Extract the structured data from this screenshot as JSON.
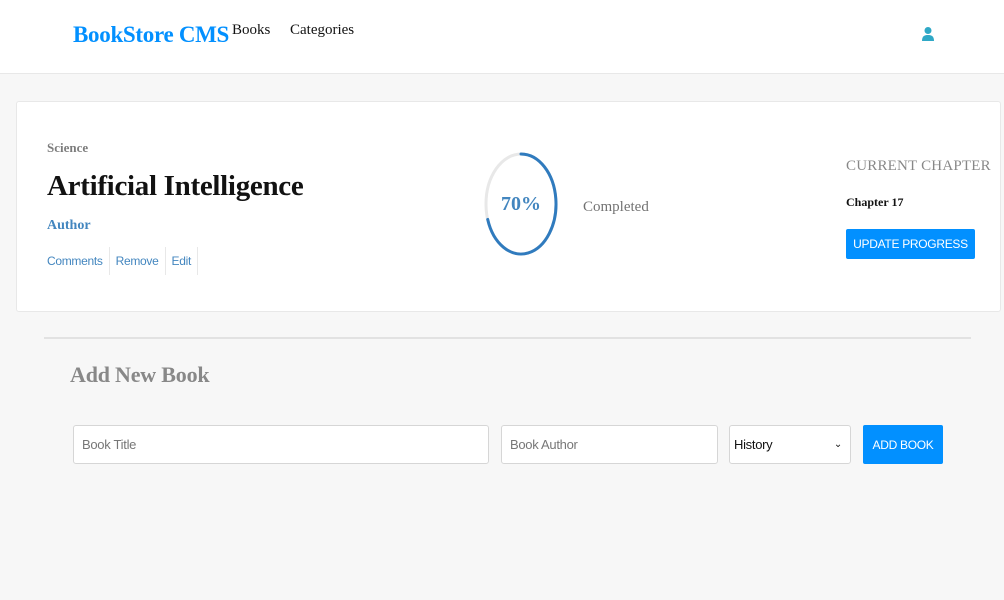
{
  "header": {
    "brand": "BookStore CMS",
    "nav": [
      {
        "label": "Books"
      },
      {
        "label": "Categories"
      }
    ],
    "user_icon": "user-icon"
  },
  "book": {
    "genre": "Science",
    "title": "Artificial Intelligence",
    "author": "Author",
    "actions": [
      {
        "label": "Comments"
      },
      {
        "label": "Remove"
      },
      {
        "label": "Edit"
      }
    ],
    "progress_percent": 70,
    "progress_label": "70%",
    "completed_label": "Completed",
    "current_chapter_heading": "CURRENT CHAPTER",
    "current_chapter": "Chapter 17",
    "update_button": "UPDATE PROGRESS"
  },
  "add_form": {
    "title": "Add New Book",
    "title_placeholder": "Book Title",
    "author_placeholder": "Book Author",
    "category_selected": "History",
    "submit_label": "ADD BOOK"
  },
  "colors": {
    "accent": "#0290ff",
    "link": "#4386bf",
    "ring_track": "#e8e8e8",
    "ring_fill": "#307bbe"
  }
}
